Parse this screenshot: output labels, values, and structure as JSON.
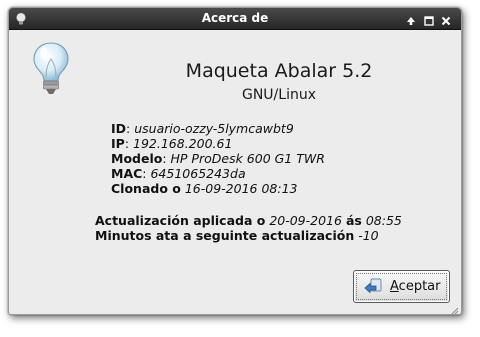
{
  "window": {
    "title": "Acerca de"
  },
  "about": {
    "app_name": "Maqueta Abalar 5.2",
    "os_name": "GNU/Linux",
    "info": [
      {
        "label": "ID",
        "sep": ": ",
        "value": "usuario-ozzy-5lymcawbt9"
      },
      {
        "label": "IP",
        "sep": ": ",
        "value": "192.168.200.61"
      },
      {
        "label": "Modelo",
        "sep": ": ",
        "value": "HP ProDesk 600 G1 TWR"
      },
      {
        "label": "MAC",
        "sep": ": ",
        "value": "6451065243da"
      },
      {
        "label": "Clonado o",
        "sep": " ",
        "value": "16-09-2016 08:13"
      }
    ]
  },
  "update": {
    "applied_label": "Actualización aplicada o",
    "applied_date": "20-09-2016",
    "at_label": "ás",
    "applied_time": "08:55",
    "minutes_label": "Minutos ata a seguinte actualización",
    "minutes_value": "-10"
  },
  "buttons": {
    "accept_mnemonic": "A",
    "accept_rest": "ceptar"
  },
  "icons": {
    "app": "lightbulb-icon",
    "accept": "accept-arrow-icon"
  },
  "colors": {
    "titlebar": "#2e2e2e",
    "dialog_bg": "#ececec"
  }
}
